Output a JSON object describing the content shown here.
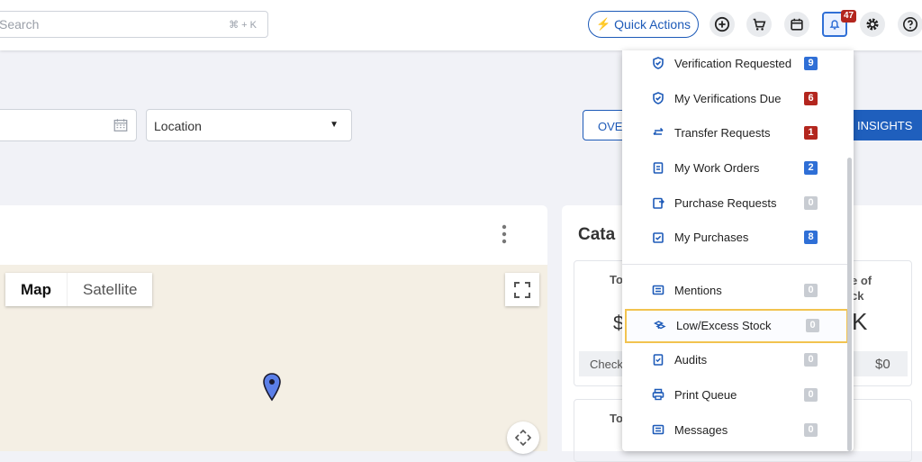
{
  "search": {
    "placeholder": "Search",
    "shortcut": "⌘ + K"
  },
  "header": {
    "quick_actions": "Quick Actions",
    "notification_count": "47"
  },
  "filters": {
    "location": "Location"
  },
  "tabs": {
    "overview": "OVE",
    "insights": "INSIGHTS"
  },
  "map": {
    "map_label": "Map",
    "satellite_label": "Satellite"
  },
  "catalog": {
    "title": "Cata",
    "card1_title": "To",
    "card1_value": "$",
    "card1_check": "Check",
    "card2_title_line1": "e of",
    "card2_title_line2": "ck",
    "card2_value": "K",
    "card2_sub": "$0",
    "card3_title": "To"
  },
  "notifications": {
    "items": [
      {
        "label": "Verification Requested",
        "count": "9",
        "color": "#2f6fd6",
        "icon": "shield-check-icon"
      },
      {
        "label": "My Verifications Due",
        "count": "6",
        "color": "#b3261e",
        "icon": "shield-check-icon"
      },
      {
        "label": "Transfer Requests",
        "count": "1",
        "color": "#b3261e",
        "icon": "transfer-arrows-icon"
      },
      {
        "label": "My Work Orders",
        "count": "2",
        "color": "#2f6fd6",
        "icon": "clipboard-list-icon"
      },
      {
        "label": "Purchase Requests",
        "count": "0",
        "color": "#c8ccd2",
        "icon": "clipboard-arrow-icon"
      },
      {
        "label": "My Purchases",
        "count": "8",
        "color": "#2f6fd6",
        "icon": "calendar-check-icon"
      },
      {
        "label": "Mentions",
        "count": "0",
        "color": "#c8ccd2",
        "icon": "message-lines-icon"
      },
      {
        "label": "Low/Excess Stock",
        "count": "0",
        "color": "#c8ccd2",
        "icon": "boxes-icon"
      },
      {
        "label": "Audits",
        "count": "0",
        "color": "#c8ccd2",
        "icon": "clipboard-check-icon"
      },
      {
        "label": "Print Queue",
        "count": "0",
        "color": "#c8ccd2",
        "icon": "printer-icon"
      },
      {
        "label": "Messages",
        "count": "0",
        "color": "#c8ccd2",
        "icon": "message-lines-icon"
      }
    ]
  }
}
